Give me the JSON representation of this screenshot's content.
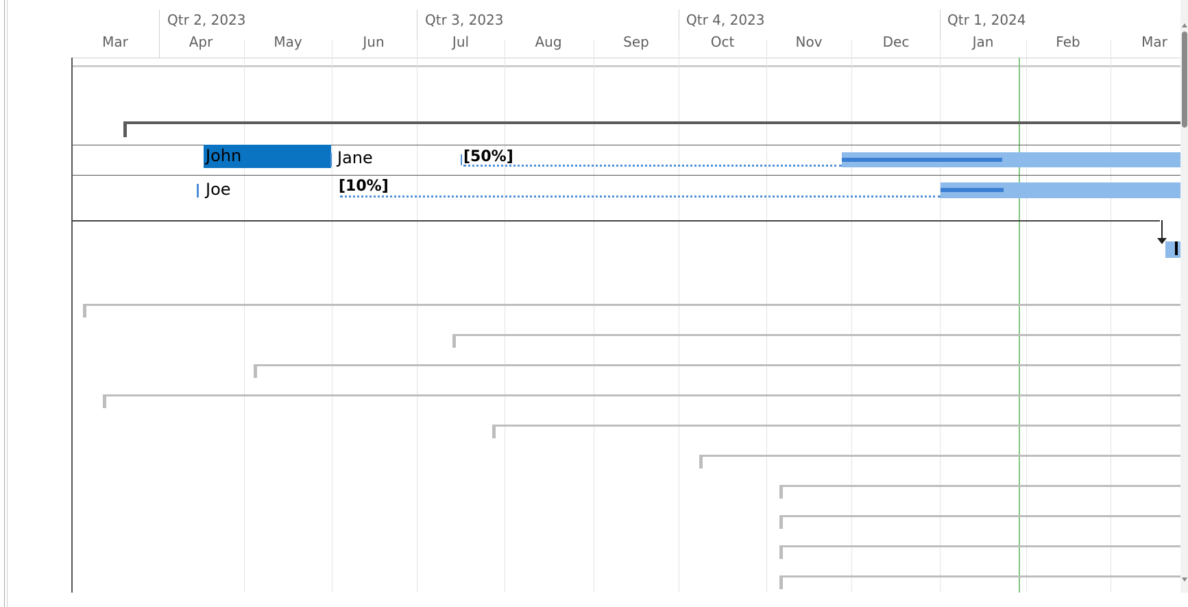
{
  "timescale": {
    "quarters": [
      "Qtr 2, 2023",
      "Qtr 3, 2023",
      "Qtr 4, 2023",
      "Qtr 1, 2024"
    ],
    "months": [
      "Mar",
      "Apr",
      "May",
      "Jun",
      "Jul",
      "Aug",
      "Sep",
      "Oct",
      "Nov",
      "Dec",
      "Jan",
      "Feb",
      "Mar"
    ]
  },
  "gantt": {
    "row1": {
      "resource_a": "John",
      "resource_b": "Jane",
      "percent": "[50%]"
    },
    "row2": {
      "resource": "Joe",
      "percent": "[10%]"
    }
  },
  "colors": {
    "selected_bar": "#0a74c3",
    "task_bar": "#8cbbeb",
    "progress_bar": "#3a7fd3",
    "dotted_link": "#4f8fd9",
    "current_date_line": "#7ec87e",
    "summary_dark": "#5b5b5b",
    "summary_light": "#bdbdbd"
  }
}
